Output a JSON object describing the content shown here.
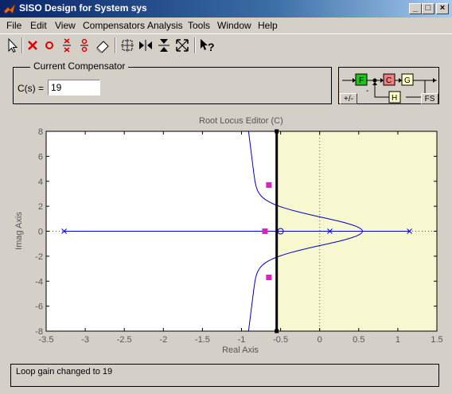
{
  "window": {
    "title": "SISO Design for System sys",
    "controls": {
      "minimize": "_",
      "maximize": "□",
      "close": "×"
    }
  },
  "menu": [
    "File",
    "Edit",
    "View",
    "Compensators",
    "Analysis",
    "Tools",
    "Window",
    "Help"
  ],
  "toolbar": {
    "tools": [
      "select-arrow",
      "add-real-pole",
      "add-real-zero",
      "add-complex-pole",
      "add-complex-zero",
      "eraser",
      "zoom-box",
      "zoom-x",
      "zoom-y",
      "zoom-fit",
      "whats-this-help"
    ]
  },
  "compensator": {
    "legend": "Current Compensator",
    "label": "C(s) =",
    "value": "19"
  },
  "block_diagram": {
    "blocks": [
      "F",
      "C",
      "G",
      "H"
    ],
    "sign": "-",
    "toggle_label": "+/-",
    "fs_label": "FS"
  },
  "root_locus": {
    "title": "Root Locus Editor (C)",
    "xlabel": "Real Axis",
    "ylabel": "Imag Axis"
  },
  "chart_data": {
    "type": "scatter",
    "title": "Root Locus Editor (C)",
    "xlabel": "Real Axis",
    "ylabel": "Imag Axis",
    "xlim": [
      -3.5,
      1.5
    ],
    "ylim": [
      -8,
      8
    ],
    "xticks": [
      "-3.5",
      "-3",
      "-2.5",
      "-2",
      "-1.5",
      "-1",
      "-0.5",
      "0",
      "0.5",
      "1",
      "1.5"
    ],
    "yticks": [
      "8",
      "6",
      "4",
      "2",
      "0",
      "-2",
      "-4",
      "-6",
      "-8"
    ],
    "open_loop_poles": [
      [
        -3.27,
        0
      ],
      [
        0.13,
        0
      ],
      [
        1.15,
        0
      ]
    ],
    "open_loop_zeros": [
      [
        -0.5,
        0
      ]
    ],
    "closed_loop_poles": [
      [
        -0.7,
        0
      ],
      [
        -0.65,
        3.7
      ],
      [
        -0.65,
        -3.7
      ]
    ],
    "stability_boundary_x": -0.55,
    "axis_lines": {
      "vertical_x": 0,
      "horizontal_y": 0
    },
    "colors": {
      "locus": "#0000c8",
      "closed_loop_pole": "#e020c0",
      "shaded_region": "#f7f7d0",
      "boundary": "#000000"
    }
  },
  "status": {
    "message": "Loop gain changed to 19"
  }
}
